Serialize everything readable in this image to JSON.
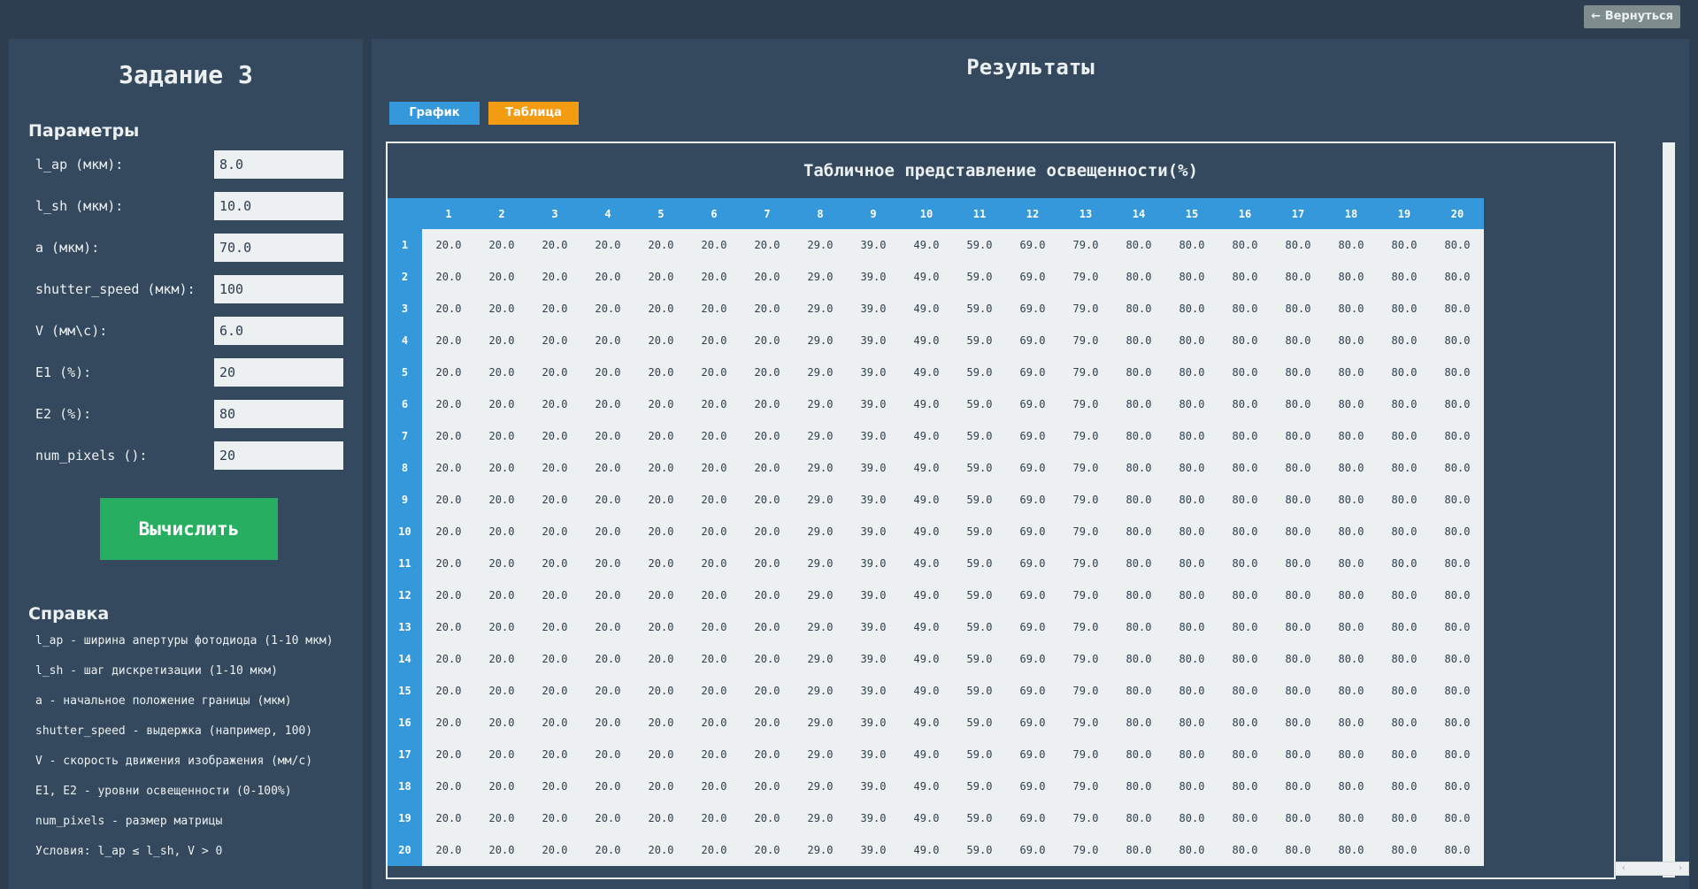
{
  "header": {
    "back_label": "← Вернуться"
  },
  "left": {
    "title": "Задание 3",
    "params_title": "Параметры",
    "params": [
      {
        "label": "l_ap (мкм):",
        "value": "8.0"
      },
      {
        "label": "l_sh (мкм):",
        "value": "10.0"
      },
      {
        "label": "a (мкм):",
        "value": "70.0"
      },
      {
        "label": "shutter_speed (мкм):",
        "value": "100"
      },
      {
        "label": "V (мм\\с):",
        "value": "6.0"
      },
      {
        "label": "E1 (%):",
        "value": "20"
      },
      {
        "label": "E2 (%):",
        "value": "80"
      },
      {
        "label": "num_pixels ():",
        "value": "20"
      }
    ],
    "compute_label": "Вычислить",
    "help_title": "Справка",
    "help_lines": [
      "l_ap - ширина апертуры фотодиода (1-10 мкм)",
      "l_sh - шаг дискретизации (1-10 мкм)",
      "a - начальное положение границы (мкм)",
      "shutter_speed - выдержка (например, 100)",
      "V - скорость движения изображения (мм/с)",
      "E1, E2 - уровни освещенности (0-100%)",
      "num_pixels - размер матрицы",
      "Условия: l_ap ≤ l_sh, V > 0"
    ]
  },
  "right": {
    "title": "Результаты",
    "tab_chart": "График",
    "tab_table": "Таблица",
    "table_title": "Табличное представление освещенности(%)",
    "columns": [
      "1",
      "2",
      "3",
      "4",
      "5",
      "6",
      "7",
      "8",
      "9",
      "10",
      "11",
      "12",
      "13",
      "14",
      "15",
      "16",
      "17",
      "18",
      "19",
      "20"
    ],
    "rows": [
      "1",
      "2",
      "3",
      "4",
      "5",
      "6",
      "7",
      "8",
      "9",
      "10",
      "11",
      "12",
      "13",
      "14",
      "15",
      "16",
      "17",
      "18",
      "19",
      "20"
    ],
    "row_values": [
      "20.0",
      "20.0",
      "20.0",
      "20.0",
      "20.0",
      "20.0",
      "20.0",
      "29.0",
      "39.0",
      "49.0",
      "59.0",
      "69.0",
      "79.0",
      "80.0",
      "80.0",
      "80.0",
      "80.0",
      "80.0",
      "80.0",
      "80.0"
    ]
  },
  "colors": {
    "background": "#2c3e50",
    "panel": "#34495e",
    "accent_blue": "#3498db",
    "accent_orange": "#f39c12",
    "accent_green": "#27ae60"
  }
}
